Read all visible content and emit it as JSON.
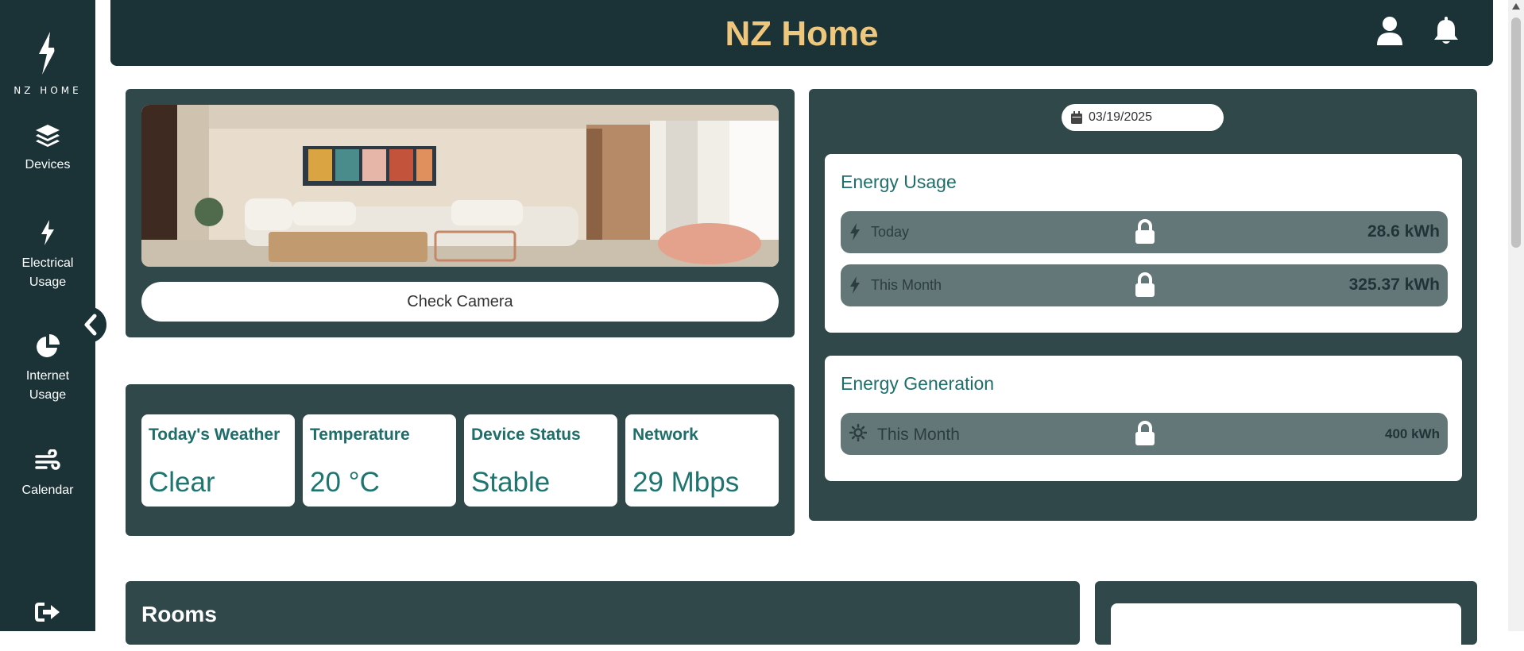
{
  "app": {
    "logo_text": "NZ HOME",
    "title": "NZ Home",
    "accent_color": "#eec77d",
    "sidebar_color": "#1b3236",
    "panel_color": "#31484b"
  },
  "sidebar": {
    "items": [
      {
        "label": "Devices",
        "icon": "layers-icon"
      },
      {
        "label": "Electrical Usage",
        "icon": "bolt-icon"
      },
      {
        "label": "Internet Usage",
        "icon": "pie-chart-icon"
      },
      {
        "label": "Calendar",
        "icon": "wind-icon"
      }
    ],
    "logout_icon": "sign-out-icon",
    "collapse_icon": "chevron-left-icon"
  },
  "header": {
    "icons": [
      "user-icon",
      "bell-icon"
    ]
  },
  "camera": {
    "image_alt": "living-room-image",
    "button_label": "Check Camera"
  },
  "stats": [
    {
      "label": "Today's Weather",
      "value": "Clear"
    },
    {
      "label": "Temperature",
      "value": "20 °C"
    },
    {
      "label": "Device Status",
      "value": "Stable"
    },
    {
      "label": "Network",
      "value": "29 Mbps"
    }
  ],
  "energy": {
    "date": "03/19/2025",
    "usage": {
      "title": "Energy Usage",
      "rows": [
        {
          "label": "Today",
          "value": "28.6 kWh"
        },
        {
          "label": "This Month",
          "value": "325.37 kWh"
        }
      ]
    },
    "generation": {
      "title": "Energy Generation",
      "rows": [
        {
          "label": "This Month",
          "value": "400 kWh"
        }
      ]
    }
  },
  "rooms": {
    "title": "Rooms"
  }
}
